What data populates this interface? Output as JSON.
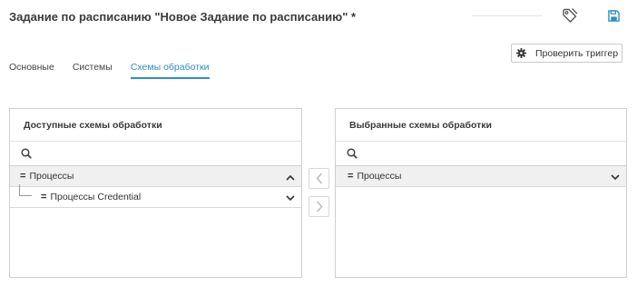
{
  "header": {
    "title": "Задание по расписанию \"Новое Задание по расписанию\" *",
    "tag_icon": "tag-icon",
    "save_icon": "save-icon"
  },
  "toolbar": {
    "check_trigger_label": "Проверить триггер",
    "check_trigger_icon": "gear-icon"
  },
  "tabs": [
    {
      "label": "Основные",
      "active": false
    },
    {
      "label": "Системы",
      "active": false
    },
    {
      "label": "Схемы обработки",
      "active": true
    }
  ],
  "available_panel": {
    "title": "Доступные схемы обработки",
    "search_icon": "search-icon",
    "tree": [
      {
        "label": "Процессы",
        "level": 0,
        "expanded": true,
        "chevron": "chevron-up-icon"
      },
      {
        "label": "Процессы Credential",
        "level": 1,
        "expanded": false,
        "chevron": "chevron-down-icon"
      }
    ]
  },
  "selected_panel": {
    "title": "Выбранные схемы обработки",
    "search_icon": "search-icon",
    "tree": [
      {
        "label": "Процессы",
        "level": 0,
        "expanded": false,
        "chevron": "chevron-down-icon"
      }
    ]
  },
  "transfer": {
    "left_icon": "chevron-left-icon",
    "right_icon": "chevron-right-icon"
  },
  "colors": {
    "accent": "#2a8fc7",
    "border": "#cfcfcf",
    "text": "#333333"
  }
}
